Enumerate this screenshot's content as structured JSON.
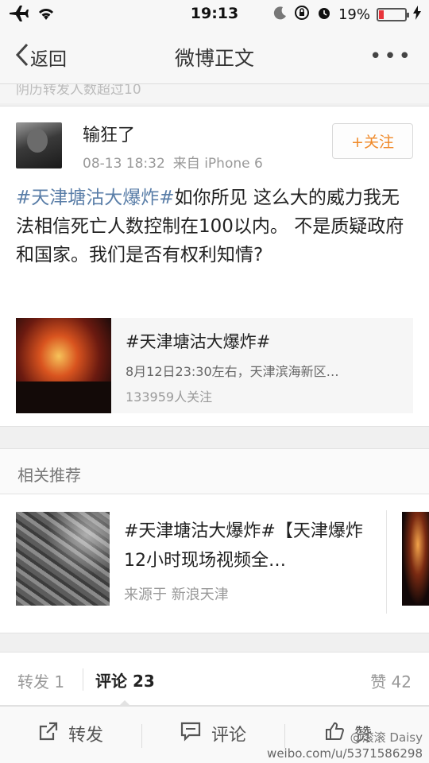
{
  "status_bar": {
    "time": "19:13",
    "battery_percent": "19%",
    "battery_level": 0.19,
    "icons": [
      "airplane-icon",
      "wifi-icon",
      "moon-icon",
      "rotation-lock-icon",
      "alarm-icon",
      "charging-icon"
    ]
  },
  "nav": {
    "back_label": "返回",
    "title": "微博正文",
    "more_label": "•••"
  },
  "ghost_text": "阴历转发人数超过10",
  "post": {
    "username": "输狂了",
    "timestamp": "08-13 18:32",
    "source": "来自 iPhone 6",
    "follow_label": "+关注",
    "topic": "#天津塘沽大爆炸#",
    "body": "如你所见 这么大的威力我无法相信死亡人数控制在100以内。 不是质疑政府和国家。我们是否有权利知情?"
  },
  "topic_card": {
    "title": "#天津塘沽大爆炸#",
    "description": "8月12日23:30左右，天津滨海新区…",
    "followers": "133959人关注"
  },
  "related": {
    "header": "相关推荐",
    "title": "#天津塘沽大爆炸#【天津爆炸12小时现场视频全…",
    "source": "来源于 新浪天津"
  },
  "stats": {
    "forward": "转发 1",
    "comment": "评论 23",
    "like": "赞 42"
  },
  "toolbar": {
    "forward": "转发",
    "comment": "评论",
    "like": "赞"
  },
  "watermark": {
    "line1": "@滚滚 Daisy",
    "line2": "weibo.com/u/5371586298"
  },
  "colors": {
    "topic_link": "#5a7ea8",
    "follow": "#f08a2a",
    "battery_low": "#e8343a"
  }
}
